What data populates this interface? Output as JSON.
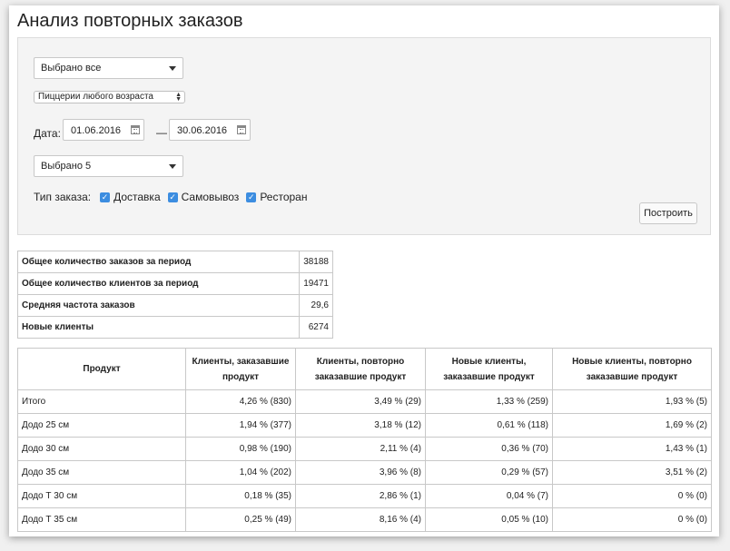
{
  "page": {
    "title": "Анализ повторных заказов"
  },
  "filters": {
    "select1": {
      "value": "Выбрано все"
    },
    "select2": {
      "value": "Пиццерии любого возраста"
    },
    "date": {
      "label": "Дата:",
      "from": "01.06.2016",
      "separator": "—",
      "to": "30.06.2016"
    },
    "select3": {
      "value": "Выбрано 5"
    },
    "order_type": {
      "label": "Тип заказа:",
      "options": [
        {
          "label": "Доставка",
          "checked": true
        },
        {
          "label": "Самовывоз",
          "checked": true
        },
        {
          "label": "Ресторан",
          "checked": true
        }
      ]
    },
    "build_label": "Построить"
  },
  "summary": {
    "rows": [
      {
        "label": "Общее количество заказов за период",
        "value": "38188"
      },
      {
        "label": "Общее количество клиентов за период",
        "value": "19471"
      },
      {
        "label": "Средняя частота заказов",
        "value": "29,6"
      },
      {
        "label": "Новые клиенты",
        "value": "6274"
      }
    ]
  },
  "products": {
    "headers": [
      "Продукт",
      "Клиенты, заказавшие продукт",
      "Клиенты, повторно заказавшие продукт",
      "Новые клиенты, заказавшие продукт",
      "Новые клиенты, повторно заказавшие продукт"
    ],
    "rows": [
      [
        "Итого",
        "4,26 % (830)",
        "3,49 % (29)",
        "1,33 % (259)",
        "1,93 % (5)"
      ],
      [
        "Додо 25 см",
        "1,94 % (377)",
        "3,18 % (12)",
        "0,61 % (118)",
        "1,69 % (2)"
      ],
      [
        "Додо 30 см",
        "0,98 % (190)",
        "2,11 % (4)",
        "0,36 % (70)",
        "1,43 % (1)"
      ],
      [
        "Додо 35 см",
        "1,04 % (202)",
        "3,96 % (8)",
        "0,29 % (57)",
        "3,51 % (2)"
      ],
      [
        "Додо Т 30 см",
        "0,18 % (35)",
        "2,86 % (1)",
        "0,04 % (7)",
        "0 % (0)"
      ],
      [
        "Додо Т 35 см",
        "0,25 % (49)",
        "8,16 % (4)",
        "0,05 % (10)",
        "0 % (0)"
      ]
    ]
  },
  "icons": {
    "calendar": "calendar-icon",
    "dropdown": "chevron-down-icon",
    "checkbox": "checkmark-icon"
  },
  "colors": {
    "checkbox": "#3c8de0",
    "panel": "#f4f4f4",
    "border": "#c8c8c8"
  }
}
